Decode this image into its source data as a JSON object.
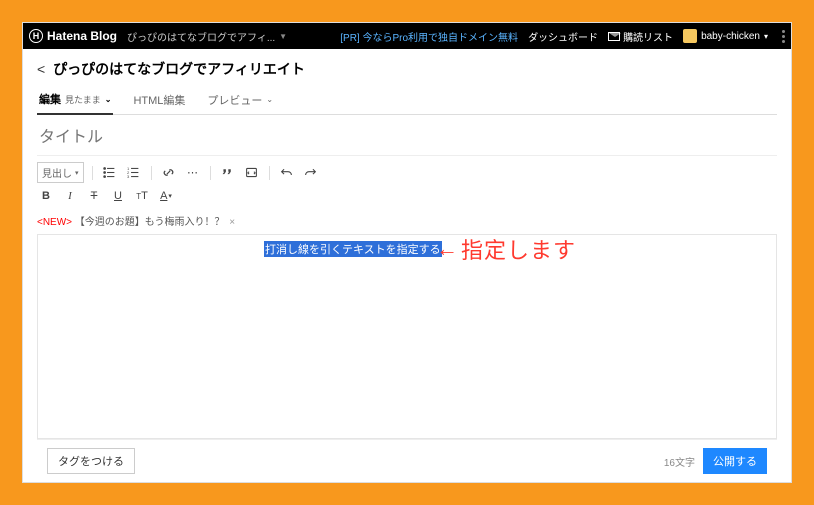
{
  "topbar": {
    "brand": "Hatena Blog",
    "subtitle": "ぴっぴのはてなブログでアフィ...",
    "pr": "[PR] 今ならPro利用で独自ドメイン無料",
    "dashboard": "ダッシュボード",
    "deliver": "購読リスト",
    "user": "baby-chicken"
  },
  "header": {
    "back": "<",
    "title": "ぴっぴのはてなブログでアフィリエイト"
  },
  "tabs": {
    "edit": "編集",
    "edit_sub": "見たまま",
    "html": "HTML編集",
    "preview": "プレビュー"
  },
  "toolbar": {
    "heading": "見出し",
    "bold": "B",
    "italic": "I",
    "strike": "T",
    "underline": "U",
    "tt": "T",
    "color": "A"
  },
  "title_placeholder": "タイトル",
  "notice": {
    "new": "<NEW>",
    "text": "【今週のお題】もう梅雨入り！？",
    "x": "×"
  },
  "editor": {
    "selected": "打消し線を引くテキストを指定する",
    "annotation": "指定します"
  },
  "footer": {
    "tag": "タグをつける",
    "count": "16文字",
    "publish": "公開する"
  }
}
